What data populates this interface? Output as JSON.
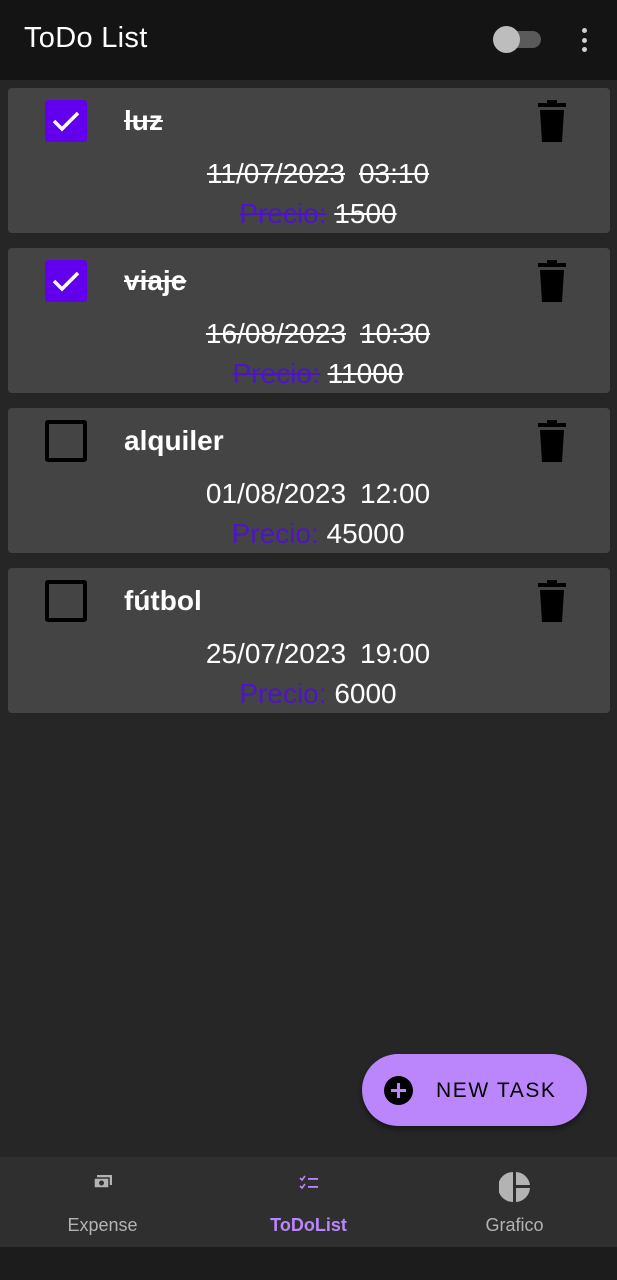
{
  "app": {
    "title": "ToDo List",
    "theme_toggle_on": false
  },
  "tasks": [
    {
      "name": "luz",
      "date": "11/07/2023",
      "time": "03:10",
      "price_label": "Precio:",
      "price": "1500",
      "done": true
    },
    {
      "name": "viaje",
      "date": "16/08/2023",
      "time": "10:30",
      "price_label": "Precio:",
      "price": "11000",
      "done": true
    },
    {
      "name": "alquiler",
      "date": "01/08/2023",
      "time": "12:00",
      "price_label": "Precio:",
      "price": "45000",
      "done": false
    },
    {
      "name": "fútbol",
      "date": "25/07/2023",
      "time": "19:00",
      "price_label": "Precio:",
      "price": "6000",
      "done": false
    }
  ],
  "fab": {
    "label": "NEW TASK",
    "icon": "add-circle-icon"
  },
  "nav": {
    "items": [
      {
        "label": "Expense",
        "icon": "money-icon",
        "active": false
      },
      {
        "label": "ToDoList",
        "icon": "checklist-icon",
        "active": true
      },
      {
        "label": "Grafico",
        "icon": "pie-chart-icon",
        "active": false
      }
    ]
  },
  "colors": {
    "accent": "#bb86fc",
    "checkbox_checked": "#6200ee",
    "price_label": "#4f14c8",
    "card": "#444444",
    "background": "#262626"
  }
}
